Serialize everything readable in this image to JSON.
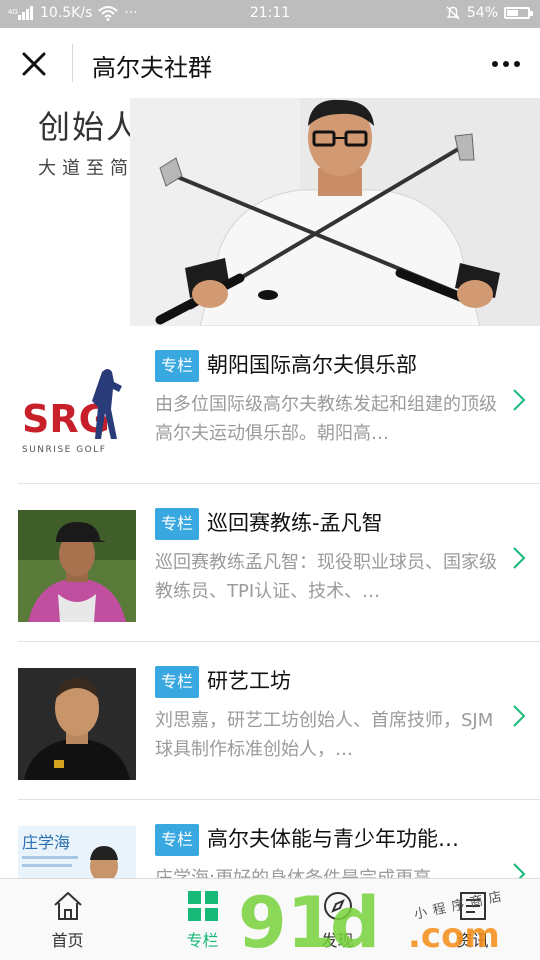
{
  "status_bar": {
    "network_speed": "10.5K/s",
    "time": "21:11",
    "battery": "54%",
    "battery_level": 0.54
  },
  "nav": {
    "title": "高尔夫社群"
  },
  "banner": {
    "title": "创始人说",
    "subtitle": "大道至简"
  },
  "items": [
    {
      "tag": "专栏",
      "title": "朝阳国际高尔夫俱乐部",
      "desc": "由多位国际级高尔夫教练发起和组建的顶级高尔夫运动俱乐部。朝阳高…",
      "logo_text": "SRG",
      "logo_sub": "SUNRISE GOLF"
    },
    {
      "tag": "专栏",
      "title": "巡回赛教练-孟凡智",
      "desc": "巡回赛教练孟凡智：现役职业球员、国家级教练员、TPI认证、技术、…"
    },
    {
      "tag": "专栏",
      "title": "研艺工坊",
      "desc": "刘思嘉，研艺工坊创始人、首席技师，SJM球具制作标准创始人，…"
    },
    {
      "tag": "专栏",
      "title": "高尔夫体能与青少年功能…",
      "desc": "庄学海:更好的身体条件是完成更高…",
      "thumb_text": "庄学海"
    }
  ],
  "tabbar": {
    "tabs": [
      {
        "label": "首页",
        "icon": "home-icon"
      },
      {
        "label": "专栏",
        "icon": "grid-icon"
      },
      {
        "label": "发现",
        "icon": "discover-icon"
      },
      {
        "label": "资讯",
        "icon": "news-icon"
      }
    ],
    "active_color": "#17b978"
  },
  "watermark": {
    "brand": "91",
    "brand2": "d",
    "suffix": ".com",
    "note": "小程序商店"
  },
  "colors": {
    "tag_blue": "#39a8e0",
    "chevron_green": "#17b978"
  }
}
